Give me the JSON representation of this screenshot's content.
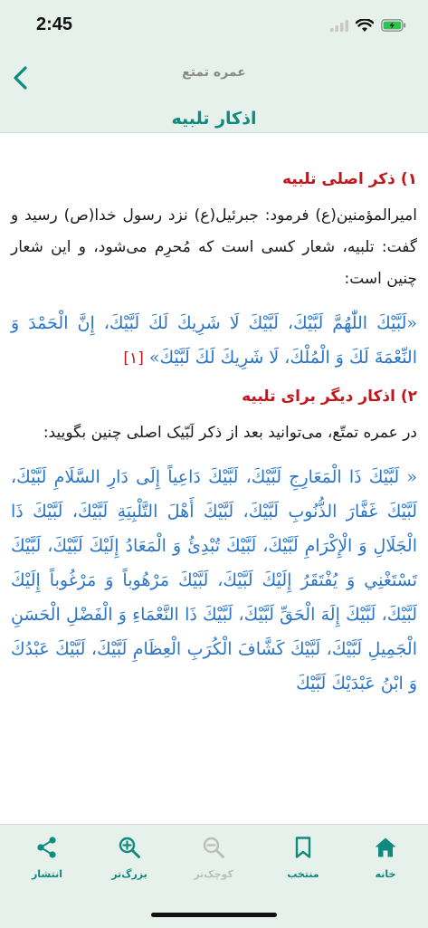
{
  "status_bar": {
    "time": "2:45"
  },
  "nav": {
    "subtitle": "عمره تمتع",
    "title": "اذکار تلبیه"
  },
  "sections": [
    {
      "heading": "۱) ذکر اصلی تلبیه",
      "body": "امیرالمؤمنین(ع) فرمود: جبرئیل(ع) نزد رسول خدا(ص) رسید و گفت: تلبیه، شعار کسی است که مُحرِم می‌شود، و این شعار چنین است:",
      "arabic": "«لَبَّيْكَ اللّٰهُمَّ لَبَّيْكَ، لَبَّيْكَ لَا شَرِيكَ لَكَ لَبَّيْكَ، إِنَّ الْحَمْدَ وَ النِّعْمَةَ لَكَ وَ الْمُلْكَ، لَا شَرِيكَ لَكَ لَبَّيْكَ»",
      "ref": "[۱]"
    },
    {
      "heading": "۲) اذکار دیگر برای تلبیه",
      "body": "در عمره تمتّع، می‌توانید بعد از ذکر لَبّیک اصلی چنین بگویید:",
      "arabic": "« لَبَّيْكَ ذَا الْمَعَارِجِ لَبَّيْكَ، لَبَّيْكَ دَاعِياً إِلَى دَارِ السَّلَامِ لَبَّيْكَ، لَبَّيْكَ غَفَّارَ الذُّنُوبِ لَبَّيْكَ، لَبَّيْكَ أَهْلَ التَّلْبِيَةِ لَبَّيْكَ، لَبَّيْكَ ذَا الْجَلَالِ وَ الْإِكْرَامِ لَبَّيْكَ، لَبَّيْكَ تُبْدِئُ وَ الْمَعَادُ إِلَيْكَ لَبَّيْكَ، لَبَّيْكَ تَسْتَغْنِي وَ يُفْتَقَرُ إِلَيْكَ لَبَّيْكَ، لَبَّيْكَ مَرْهُوباً وَ مَرْغُوباً إِلَيْكَ لَبَّيْكَ، لَبَّيْكَ إِلَهَ الْحَقِّ لَبَّيْكَ، لَبَّيْكَ ذَا النَّعْمَاءِ وَ الْفَضْلِ الْحَسَنِ الْجَمِيلِ لَبَّيْكَ، لَبَّيْكَ كَشَّافَ الْكُرَبِ الْعِظَامِ لَبَّيْكَ، لَبَّيْكَ عَبْدُكَ وَ ابْنُ عَبْدَيْكَ لَبَّيْكَ"
    }
  ],
  "tabs": [
    {
      "label": "انتشار",
      "icon": "share-icon",
      "disabled": false
    },
    {
      "label": "بزرگ‌تر",
      "icon": "zoom-in-icon",
      "disabled": false
    },
    {
      "label": "کوچک‌تر",
      "icon": "zoom-out-icon",
      "disabled": true
    },
    {
      "label": "منتخب",
      "icon": "bookmark-icon",
      "disabled": false
    },
    {
      "label": "خانه",
      "icon": "home-icon",
      "disabled": false
    }
  ],
  "colors": {
    "accent": "#0f8a7e",
    "heading": "#c0161c",
    "arabic_text": "#2b75c7",
    "bar_background": "#e7f1ec",
    "disabled": "#b7c0bd"
  }
}
